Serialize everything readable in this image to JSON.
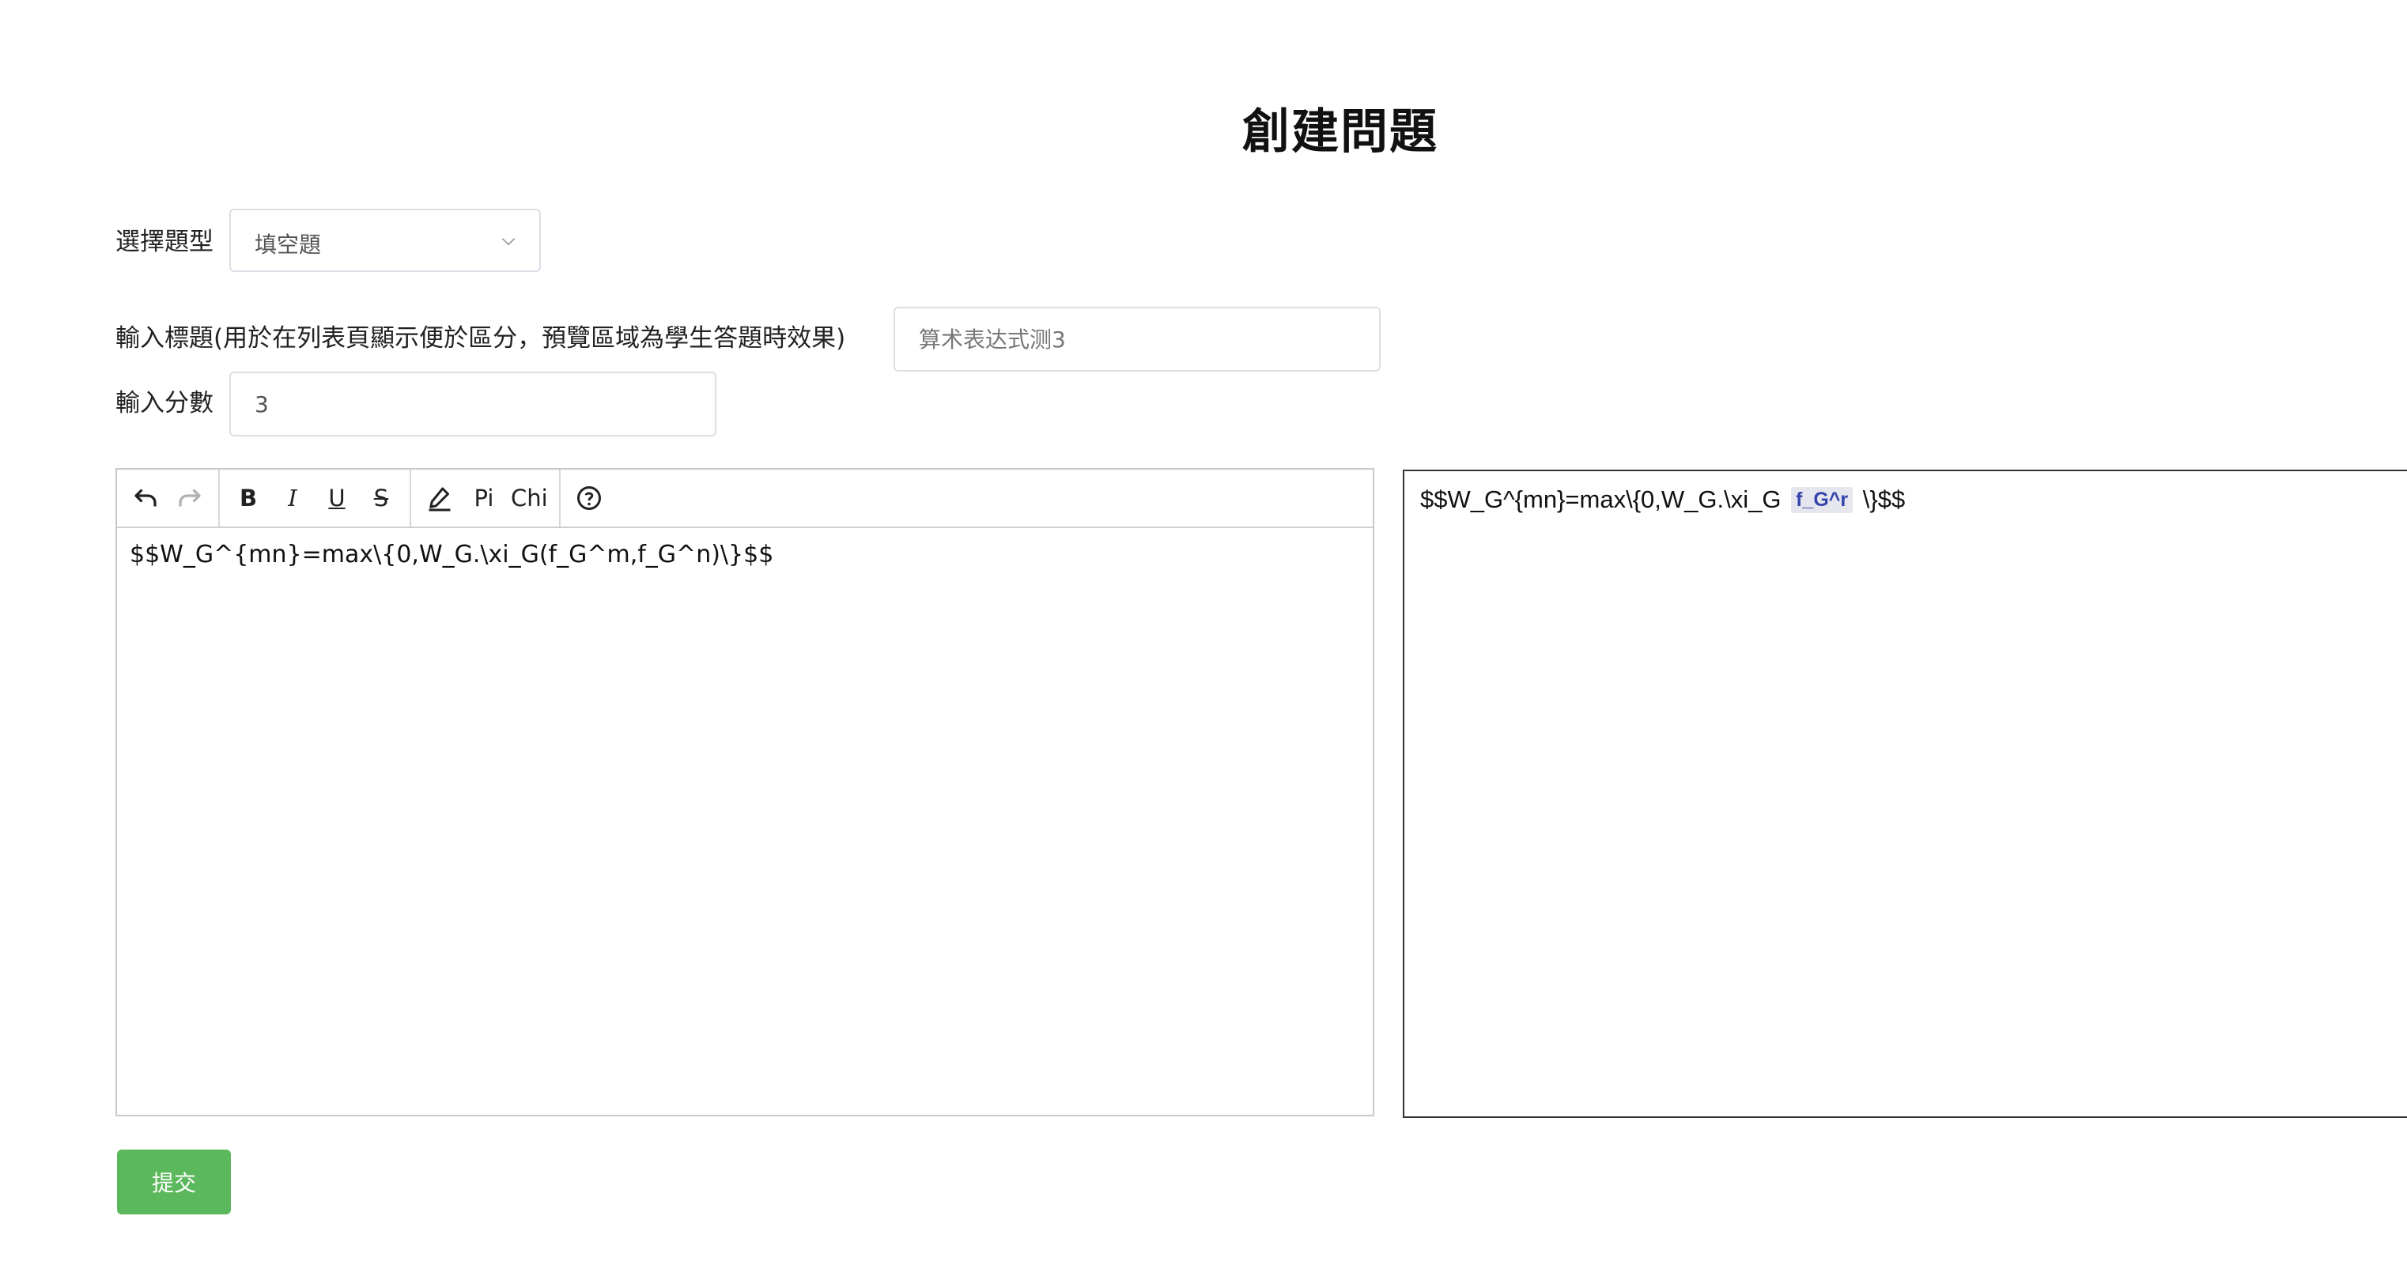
{
  "page": {
    "title": "創建問題"
  },
  "form": {
    "type_label": "選擇題型",
    "type_value": "填空題",
    "title_label": "輸入標題(用於在列表頁顯示便於區分，預覽區域為學生答題時效果)",
    "title_placeholder": "算术表达式测3",
    "score_label": "輸入分數",
    "score_value": "3"
  },
  "toolbar": {
    "undo": "undo-icon",
    "redo": "redo-icon",
    "bold": "B",
    "italic": "I",
    "underline": "U",
    "strikethrough": "S",
    "highlight": "pencil-icon",
    "pi_label": "Pi",
    "chi_label": "Chi",
    "help": "question-circle-icon"
  },
  "editor": {
    "content": "$$W_G^{mn}=max\\{0,W_G.\\xi_G(f_G^m,f_G^n)\\}$$"
  },
  "preview": {
    "before": "$$W_G^{mn}=max\\{0,W_G.\\xi_G",
    "blank": "f_G^r",
    "after": "\\}$$"
  },
  "actions": {
    "submit_label": "提交"
  },
  "colors": {
    "submit_bg": "#5cb85c",
    "blank_text": "#3344aa"
  }
}
